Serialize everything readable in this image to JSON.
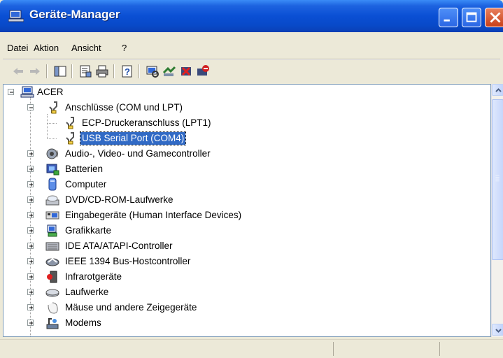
{
  "window": {
    "title": "Geräte-Manager"
  },
  "menu": [
    {
      "label": "Datei"
    },
    {
      "label": "Aktion"
    },
    {
      "label": "Ansicht"
    },
    {
      "label": "?"
    }
  ],
  "toolbar": {
    "icons": [
      "back-arrow-icon",
      "forward-arrow-icon",
      "console-tree-icon",
      "properties-icon",
      "print-icon",
      "help-icon",
      "scan-hardware-icon",
      "update-driver-icon",
      "uninstall-icon",
      "disable-icon"
    ]
  },
  "tree": {
    "root": {
      "label": "ACER",
      "expanded": true
    },
    "nodes": [
      {
        "label": "Anschlüsse (COM und LPT)",
        "expanded": true,
        "icon": "port-icon"
      },
      {
        "label": "ECP-Druckeranschluss (LPT1)",
        "icon": "port-icon",
        "child": true
      },
      {
        "label": "USB Serial Port (COM4)",
        "icon": "port-icon",
        "child": true,
        "selected": true
      },
      {
        "label": "Audio-, Video- und Gamecontroller",
        "icon": "audio-icon"
      },
      {
        "label": "Batterien",
        "icon": "battery-icon"
      },
      {
        "label": "Computer",
        "icon": "computer-icon"
      },
      {
        "label": "DVD/CD-ROM-Laufwerke",
        "icon": "cdrom-icon"
      },
      {
        "label": "Eingabegeräte (Human Interface Devices)",
        "icon": "hid-icon"
      },
      {
        "label": "Grafikkarte",
        "icon": "display-adapter-icon"
      },
      {
        "label": "IDE ATA/ATAPI-Controller",
        "icon": "ide-controller-icon"
      },
      {
        "label": "IEEE 1394 Bus-Hostcontroller",
        "icon": "firewire-icon"
      },
      {
        "label": "Infrarotgeräte",
        "icon": "infrared-icon"
      },
      {
        "label": "Laufwerke",
        "icon": "disk-drive-icon"
      },
      {
        "label": "Mäuse und andere Zeigegeräte",
        "icon": "mouse-icon"
      },
      {
        "label": "Modems",
        "icon": "modem-icon"
      }
    ]
  },
  "colors": {
    "titlebar": "#0a4fd4",
    "selection": "#316ac5",
    "window_bg": "#ece9d8"
  }
}
